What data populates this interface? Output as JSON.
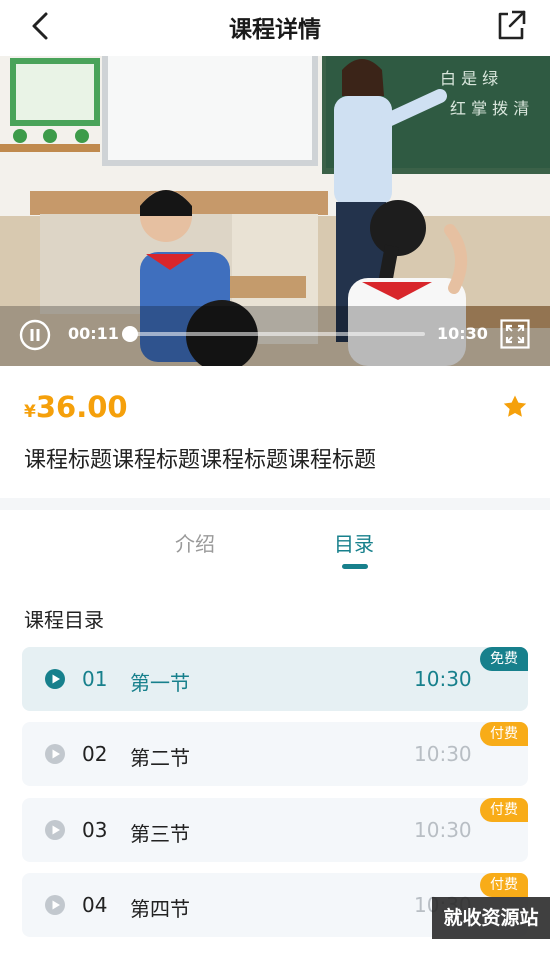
{
  "header": {
    "title": "课程详情",
    "back_icon": "chevron-left-icon",
    "share_icon": "share-external-icon"
  },
  "video": {
    "current_time": "00:11",
    "total_time": "10:30",
    "progress": 0.018,
    "play_state_icon": "pause-icon",
    "fullscreen_icon": "fullscreen-icon"
  },
  "course": {
    "currency": "¥",
    "price": "36.00",
    "title": "课程标题课程标题课程标题课程标题",
    "favorite_icon": "star-icon"
  },
  "tabs": [
    {
      "label": "介绍",
      "active": false
    },
    {
      "label": "目录",
      "active": true
    }
  ],
  "catalog": {
    "title": "课程目录",
    "lessons": [
      {
        "number": "01",
        "name": "第一节",
        "duration": "10:30",
        "badge": "免费",
        "active": true
      },
      {
        "number": "02",
        "name": "第二节",
        "duration": "10:30",
        "badge": "付费",
        "active": false
      },
      {
        "number": "03",
        "name": "第三节",
        "duration": "10:30",
        "badge": "付费",
        "active": false
      },
      {
        "number": "04",
        "name": "第四节",
        "duration": "10:30",
        "badge": "付费",
        "active": false
      }
    ]
  },
  "watermark": "就收资源站",
  "colors": {
    "accent": "#17808c",
    "price": "#f5a00b",
    "paid_badge": "#f8ac18",
    "free_badge": "#17808c"
  }
}
